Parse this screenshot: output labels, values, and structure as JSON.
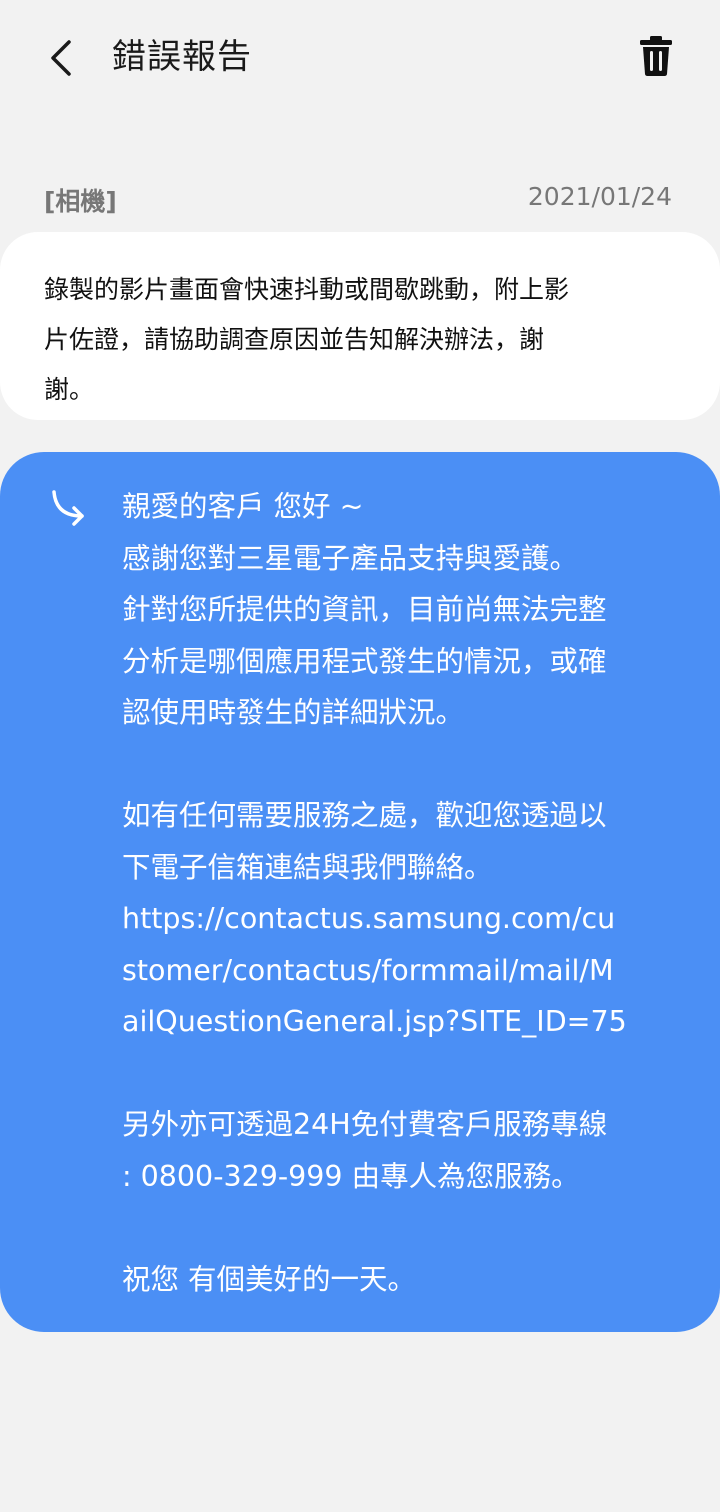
{
  "header": {
    "title": "錯誤報告",
    "back_icon": "chevron-left-icon",
    "delete_icon": "trash-icon"
  },
  "report": {
    "category": "[相機]",
    "date": "2021/01/24",
    "question": "錄製的影片畫面會快速抖動或間歇跳動，附上影\n片佐證，請協助調查原因並告知解決辦法，謝\n謝。"
  },
  "reply": {
    "icon": "reply-arrow-icon",
    "text": "親愛的客戶 您好 ~\n感謝您對三星電子產品支持與愛護。\n針對您所提供的資訊，目前尚無法完整\n分析是哪個應用程式發生的情況，或確\n認使用時發生的詳細狀況。\n\n如有任何需要服務之處，歡迎您透過以\n下電子信箱連結與我們聯絡。\nhttps://contactus.samsung.com/cu\nstomer/contactus/formmail/mail/M\nailQuestionGeneral.jsp?SITE_ID=75\n\n另外亦可透過24H免付費客戶服務專線\n: 0800-329-999 由專人為您服務。\n\n祝您 有個美好的一天。",
    "bubble_color": "#4b8ff5"
  }
}
